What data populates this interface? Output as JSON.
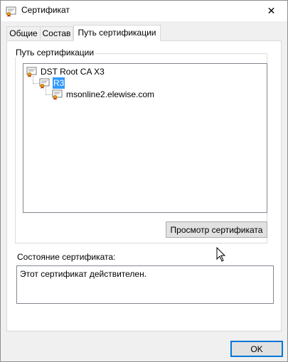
{
  "window": {
    "title": "Сертификат",
    "close_glyph": "✕"
  },
  "tabs": [
    {
      "label": "Общие",
      "active": false
    },
    {
      "label": "Состав",
      "active": false
    },
    {
      "label": "Путь сертификации",
      "active": true
    }
  ],
  "certification_path": {
    "group_label": "Путь сертификации",
    "tree": [
      {
        "label": "DST Root CA X3",
        "level": 0,
        "selected": false,
        "icon": "certificate-icon"
      },
      {
        "label": "R3",
        "level": 1,
        "selected": true,
        "icon": "certificate-icon"
      },
      {
        "label": "msonline2.elewise.com",
        "level": 2,
        "selected": false,
        "icon": "certificate-icon"
      }
    ],
    "view_button_label": "Просмотр сертификата"
  },
  "status": {
    "label": "Состояние сертификата:",
    "text": "Этот сертификат действителен."
  },
  "footer": {
    "ok_label": "OK"
  },
  "colors": {
    "selection": "#3399ff",
    "focus_border": "#0078d7"
  }
}
